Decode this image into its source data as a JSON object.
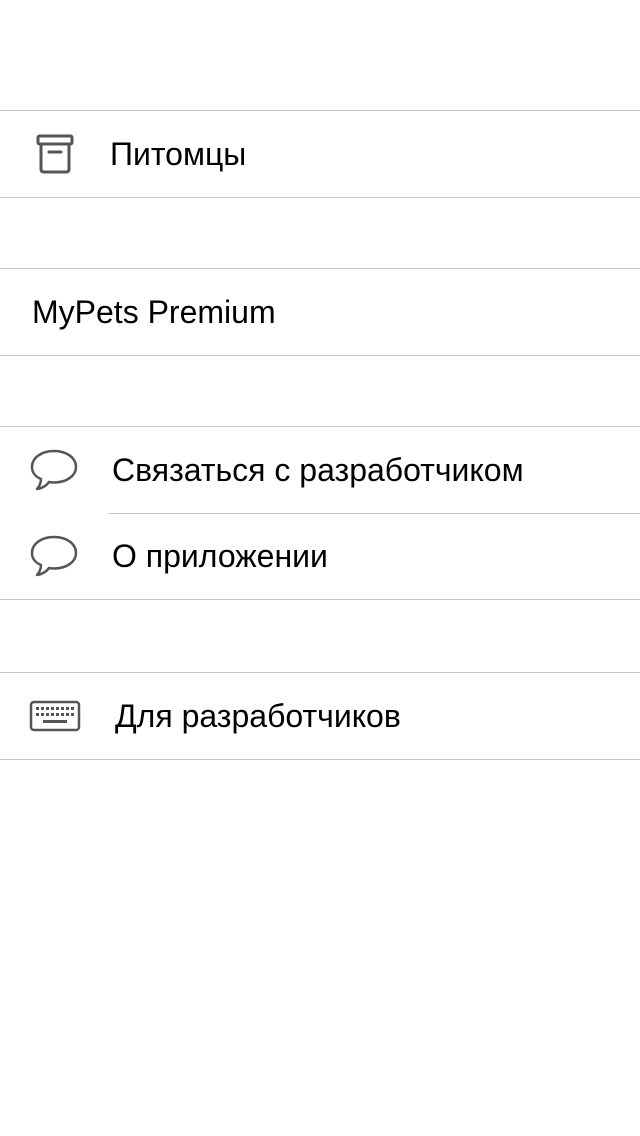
{
  "menu": {
    "pets": {
      "label": "Питомцы",
      "icon": "archive-box-icon"
    },
    "premium": {
      "label": "MyPets Premium"
    },
    "contact": {
      "label": "Связаться с разработчиком",
      "icon": "speech-bubble-icon"
    },
    "about": {
      "label": "О приложении",
      "icon": "speech-bubble-icon"
    },
    "developers": {
      "label": "Для разработчиков",
      "icon": "keyboard-icon"
    }
  },
  "colors": {
    "separator": "#c8c7cc",
    "icon": "#555555",
    "text": "#000000",
    "background": "#ffffff"
  }
}
